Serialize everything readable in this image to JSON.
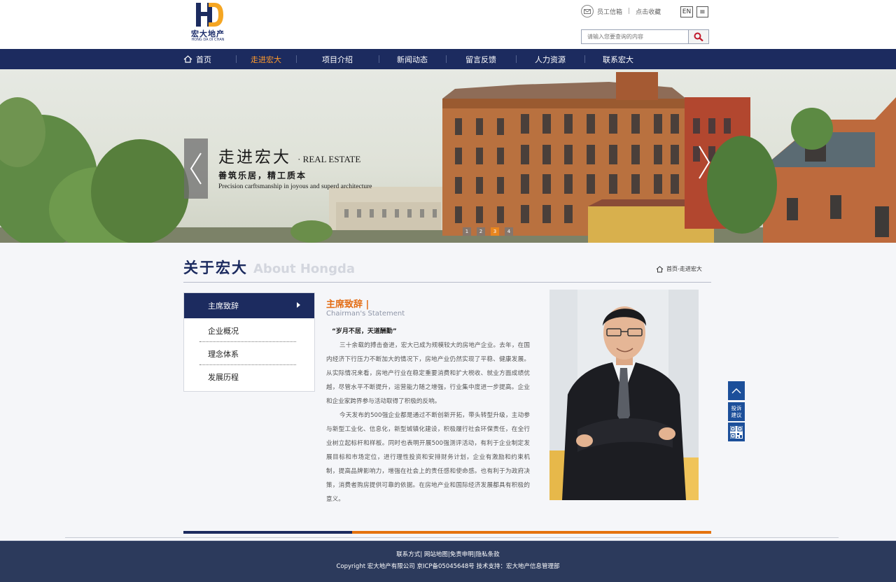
{
  "brand": {
    "cn": "宏大地产",
    "en": "HONG DA DI CHAN",
    "colors": {
      "navy": "#1c2b5f",
      "orange": "#e5730f",
      "gold": "#f5a623",
      "footer": "#2c3a5c"
    }
  },
  "util": {
    "mail_icon": "mail-icon",
    "staff_mail": "员工信箱",
    "separator": "|",
    "bookmark": "点击收藏",
    "lang": "EN",
    "menu_glyph": "≡"
  },
  "search": {
    "placeholder": "请输入您要查询的内容",
    "icon": "search-icon"
  },
  "nav": {
    "items": [
      {
        "label": "首页",
        "icon": "home-icon"
      },
      {
        "label": "走进宏大",
        "active": true
      },
      {
        "label": "项目介绍"
      },
      {
        "label": "新闻动态"
      },
      {
        "label": "留言反馈"
      },
      {
        "label": "人力资源"
      },
      {
        "label": "联系宏大"
      }
    ]
  },
  "banner": {
    "title_cn": "走进宏大",
    "title_en": "· REAL ESTATE",
    "subtitle": "善筑乐居，精工质本",
    "tagline": "Precision carftsmanship in joyous and superd architecture",
    "dots": [
      "1",
      "2",
      "3",
      "4"
    ],
    "active_dot": 3
  },
  "section": {
    "title_cn": "关于宏大",
    "title_en": "About Hongda",
    "breadcrumb": "首页-走进宏大"
  },
  "sidebar": {
    "items": [
      {
        "label": "主席致辞",
        "active": true
      },
      {
        "label": "企业概况"
      },
      {
        "label": "理念体系"
      },
      {
        "label": "发展历程"
      }
    ]
  },
  "article": {
    "title": "主席致辞 |",
    "subtitle": "Chairman's Statement",
    "quote": "“岁月不居，天道酬勤”",
    "paragraphs": [
      "三十余载的搏击奋进，宏大已成为规模较大的房地产企业。去年，在国内经济下行压力不断加大的情况下，房地产业仍然实现了平稳、健康发展。从实际情况来看，房地产行业在稳定重要消费和扩大税收、就业方面成绩优越，尽管水平不断提升，运营能力随之增强，行业集中度进一步提高。企业和企业家跨界参与活动取得了积极的反响。",
      "今天发布的500强企业都是通过不断创新开拓，带头转型升级，主动参与新型工业化、信息化，新型城镇化建设，积极履行社会环保责任，在全行业树立起标杆和样板。同时也表明开展500强测评活动，有利于企业制定发展目标和市场定位，进行理性投资和安排财务计划，企业有激励和约束机制，提高品牌影响力，增强在社会上的责任感和使命感。也有利于为政府决策，消费者购房提供可靠的依据。在房地产业和国际经济发展都具有积极的意义。"
    ]
  },
  "float_tools": {
    "top_icon": "arrow-up-icon",
    "feedback_line1": "投诉",
    "feedback_line2": "建议",
    "qr_icon": "qr-code-icon"
  },
  "footer": {
    "links": [
      "联系方式",
      "网站地图",
      "免责申明",
      "隐私条款"
    ],
    "link_sep": "|",
    "copyright": "Copyright 宏大地产有限公司 京ICP备05045648号 技术支持：宏大地产信息管理部"
  }
}
